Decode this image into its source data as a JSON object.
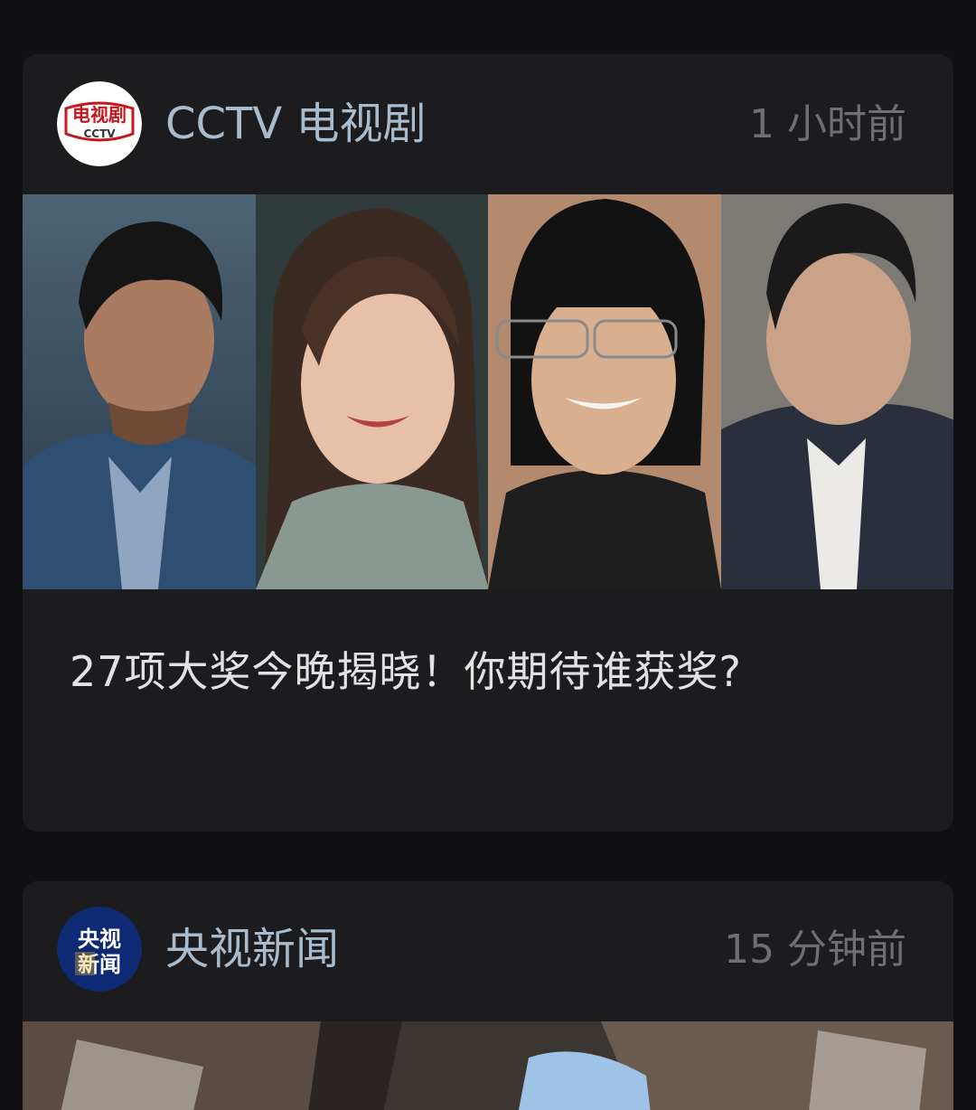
{
  "feed": {
    "posts": [
      {
        "source_name": "CCTV 电视剧",
        "timestamp": "1 小时前",
        "avatar": {
          "text_top": "电视剧",
          "text_bottom": "CCTV",
          "colors": {
            "bg": "#ffffff",
            "accent": "#c8161d"
          }
        },
        "headline": "27项大奖今晚揭晓！你期待谁获奖?",
        "image": "four-actor-portraits"
      },
      {
        "source_name": "央视新闻",
        "timestamp": "15 分钟前",
        "avatar": {
          "text_top": "央视",
          "text_bottom": "新闻",
          "colors": {
            "bg": "#0f2a74",
            "accent": "#ffffff",
            "highlight": "#e8b62b"
          }
        },
        "image": "alley-buildings-looking-up"
      }
    ]
  },
  "colors": {
    "background": "#111113",
    "card": "#1c1c1e",
    "source_name": "#a9bccd",
    "timestamp": "#6e6e73",
    "headline": "#e2e2e4"
  }
}
